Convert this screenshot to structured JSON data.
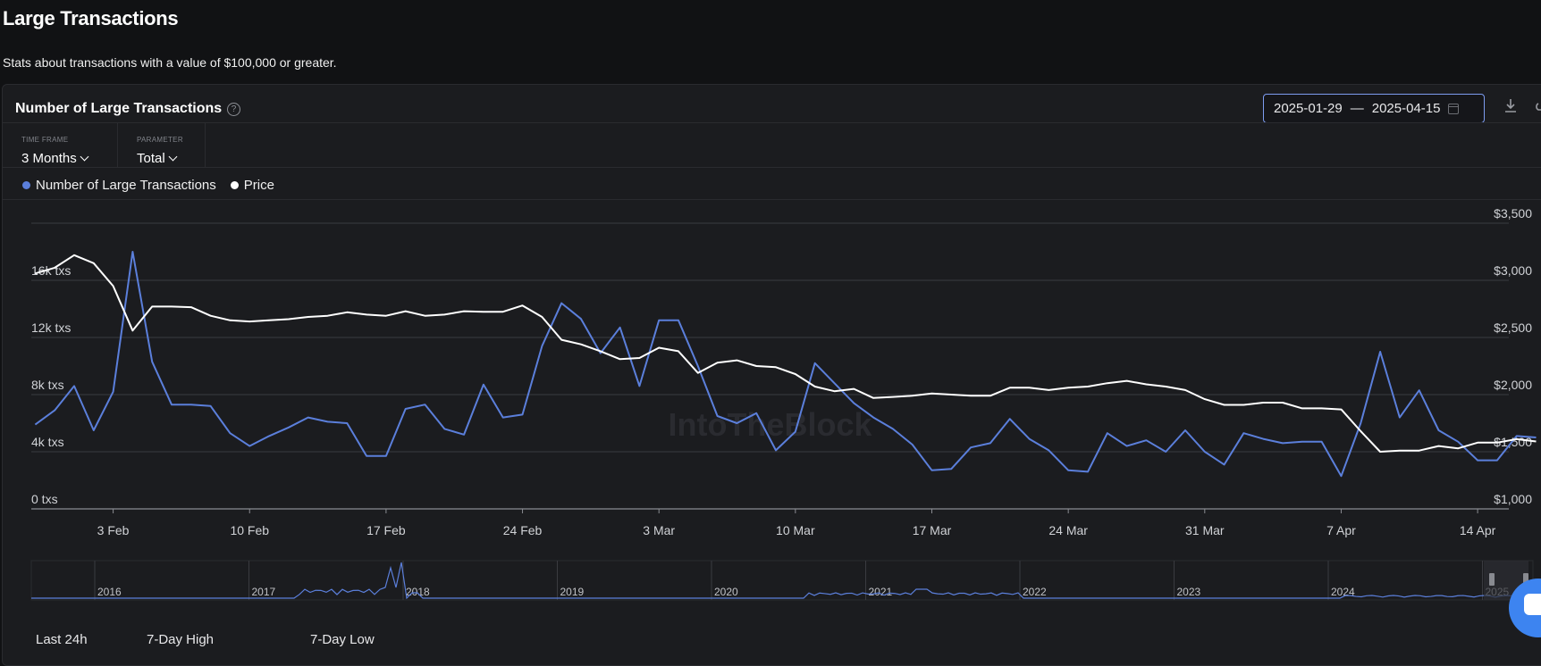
{
  "page": {
    "title": "Large Transactions",
    "subtitle": "Stats about transactions with a value of $100,000 or greater."
  },
  "card": {
    "title": "Number of Large Transactions",
    "help_icon": "question-circle-icon",
    "date_from": "2025-01-29",
    "date_sep": "—",
    "date_to": "2025-04-15"
  },
  "controls": {
    "time_frame": {
      "label": "TIME FRAME",
      "value": "3 Months"
    },
    "parameter": {
      "label": "PARAMETER",
      "value": "Total"
    }
  },
  "colors": {
    "transactions": "#5b7fdb",
    "price": "#ffffff",
    "background": "#1b1c1f"
  },
  "chart_data": {
    "type": "line",
    "title": "",
    "grid": true,
    "x_ticks": [
      "3 Feb",
      "10 Feb",
      "17 Feb",
      "24 Feb",
      "3 Mar",
      "10 Mar",
      "17 Mar",
      "24 Mar",
      "31 Mar",
      "7 Apr",
      "14 Apr"
    ],
    "x_tick_positions": [
      4,
      11,
      18,
      25,
      32,
      39,
      46,
      53,
      60,
      67,
      74
    ],
    "x_range": [
      -0.2,
      75.6
    ],
    "y_left": {
      "ticks": [
        "0 txs",
        "4k txs",
        "8k txs",
        "12k txs",
        "16k txs"
      ],
      "tick_values": [
        0,
        4000,
        8000,
        12000,
        16000
      ],
      "range": [
        0,
        20000
      ]
    },
    "y_right": {
      "ticks": [
        "$1,000",
        "$1,500",
        "$2,000",
        "$2,500",
        "$3,000",
        "$3,500"
      ],
      "tick_values": [
        1000,
        1500,
        2000,
        2500,
        3000,
        3500
      ],
      "range": [
        1000,
        3500
      ]
    },
    "series": [
      {
        "name": "Number of Large Transactions",
        "axis": "left",
        "values": [
          5900,
          6900,
          8600,
          5500,
          8200,
          18000,
          10300,
          7300,
          7300,
          7200,
          5300,
          4400,
          5100,
          5700,
          6400,
          6100,
          6000,
          3700,
          3700,
          7000,
          7300,
          5600,
          5200,
          8700,
          6400,
          6600,
          11400,
          14400,
          13300,
          10900,
          12700,
          8600,
          13200,
          13200,
          10000,
          6500,
          6000,
          6700,
          4100,
          5400,
          10200,
          8800,
          7400,
          6400,
          5600,
          4500,
          2700,
          2800,
          4300,
          4600,
          6300,
          4900,
          4100,
          2700,
          2600,
          5300,
          4400,
          4800,
          4000,
          5500,
          4000,
          3100,
          5300,
          4900,
          4600,
          4700,
          4700,
          2300,
          6000,
          11000,
          6400,
          8300,
          5500,
          4700,
          3400,
          3400,
          5100,
          5000
        ]
      },
      {
        "name": "Price",
        "axis": "right",
        "values": [
          3060,
          3110,
          3220,
          3150,
          2950,
          2560,
          2770,
          2770,
          2765,
          2690,
          2650,
          2640,
          2650,
          2660,
          2680,
          2690,
          2720,
          2700,
          2690,
          2730,
          2690,
          2700,
          2730,
          2725,
          2725,
          2780,
          2680,
          2480,
          2440,
          2380,
          2310,
          2320,
          2410,
          2380,
          2190,
          2280,
          2300,
          2250,
          2240,
          2180,
          2070,
          2030,
          2050,
          1970,
          1980,
          1990,
          2010,
          2000,
          1990,
          1990,
          2060,
          2060,
          2040,
          2060,
          2070,
          2100,
          2120,
          2090,
          2070,
          2040,
          1960,
          1910,
          1910,
          1930,
          1930,
          1880,
          1880,
          1870,
          1680,
          1500,
          1510,
          1510,
          1550,
          1530,
          1580,
          1580,
          1610,
          1590
        ]
      }
    ],
    "navigator": {
      "labels": [
        "2016",
        "2017",
        "2018",
        "2019",
        "2020",
        "2021",
        "2022",
        "2023",
        "2024",
        "2025"
      ]
    }
  },
  "stats": {
    "last_24h": "Last 24h",
    "high_7d": "7-Day High",
    "low_7d": "7-Day Low"
  },
  "watermark": "IntoTheBlock"
}
